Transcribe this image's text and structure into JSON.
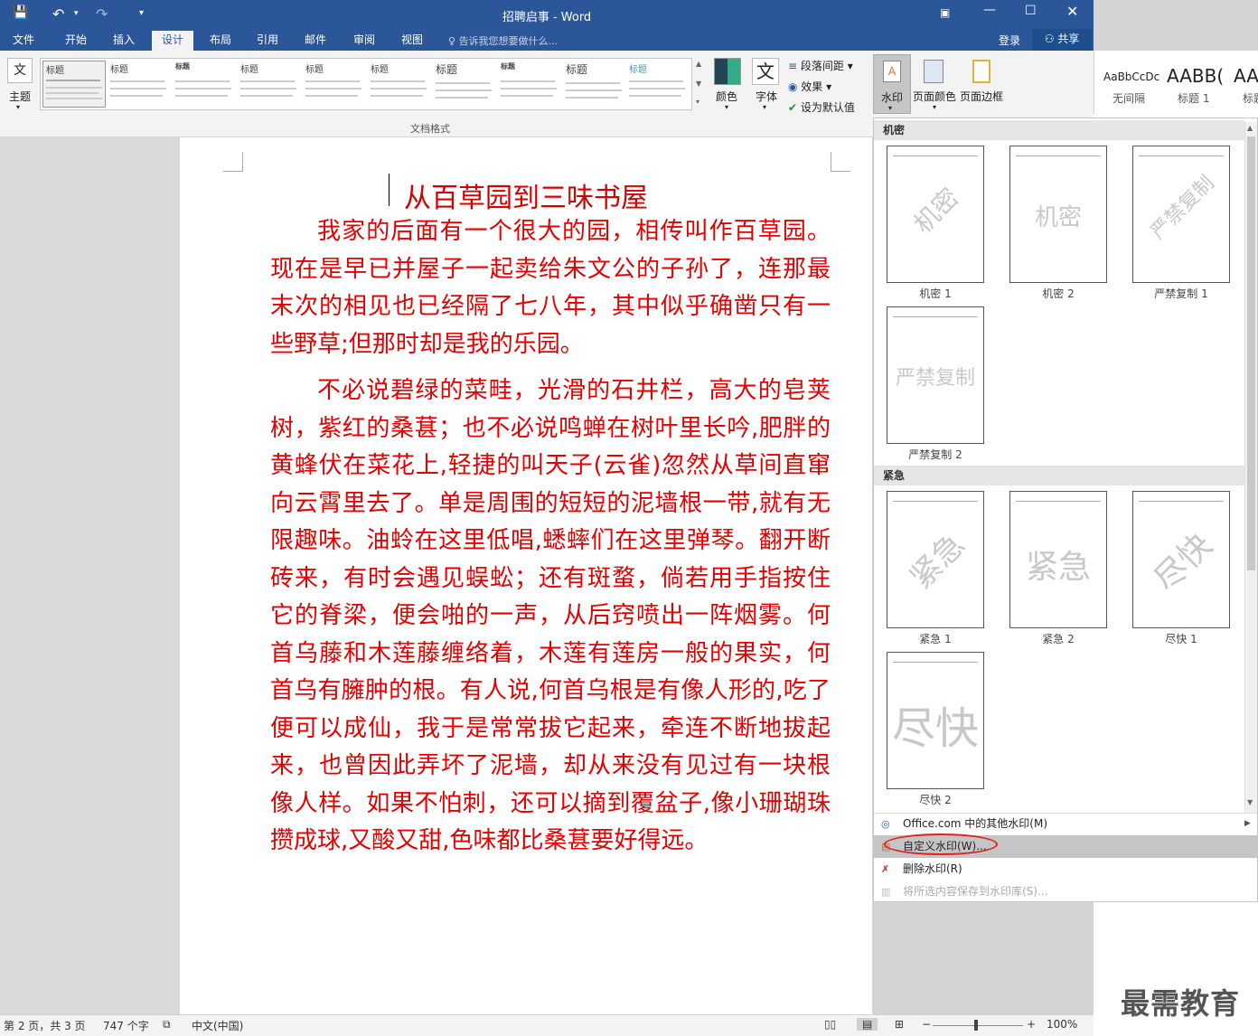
{
  "window": {
    "title": "招聘启事 - Word"
  },
  "qat": {
    "save": "💾",
    "undo": "↶",
    "redo": "↷",
    "more": "▾"
  },
  "tabs": [
    "文件",
    "开始",
    "插入",
    "设计",
    "布局",
    "引用",
    "邮件",
    "审阅",
    "视图"
  ],
  "tell_me": "告诉我您想要做什么...",
  "account": {
    "login": "登录",
    "share": "共享"
  },
  "ribbon": {
    "theme_label": "主题",
    "gallery_title_words": [
      "标题",
      "标题",
      "标题",
      "标题",
      "标题",
      "标题",
      "标题",
      "标题",
      "标题",
      "标题"
    ],
    "group_label": "文档格式",
    "colors_label": "颜色",
    "fonts_label": "字体",
    "font_glyph": "文",
    "paragraph_spacing": "段落间距",
    "effects": "效果",
    "set_default": "设为默认值",
    "watermark": "水印",
    "page_color": "页面颜色",
    "page_borders": "页面边框"
  },
  "styles_pane": {
    "items": [
      {
        "sample": "AaBbCcDc",
        "label": "无间隔"
      },
      {
        "sample": "AABB(",
        "label": "标题 1"
      },
      {
        "sample": "AAE",
        "label": "标题"
      }
    ]
  },
  "document": {
    "title": "从百草园到三味书屋",
    "paragraphs": [
      "我家的后面有一个很大的园，相传叫作百草园。现在是早已并屋子一起卖给朱文公的子孙了，连那最末次的相见也已经隔了七八年，其中似乎确凿只有一些野草;但那时却是我的乐园。",
      "不必说碧绿的菜畦，光滑的石井栏，高大的皂荚树，紫红的桑葚；也不必说鸣蝉在树叶里长吟,肥胖的黄蜂伏在菜花上,轻捷的叫天子(云雀)忽然从草间直窜向云霄里去了。单是周围的短短的泥墙根一带,就有无限趣味。油蛉在这里低唱,蟋蟀们在这里弹琴。翻开断砖来，有时会遇见蜈蚣；还有斑蝥，倘若用手指按住它的脊梁，便会啪的一声，从后窍喷出一阵烟雾。何首乌藤和木莲藤缠络着，木莲有莲房一般的果实，何首乌有臃肿的根。有人说,何首乌根是有像人形的,吃了便可以成仙，我于是常常拔它起来，牵连不断地拔起来，也曾因此弄坏了泥墙，却从来没有见过有一块根像人样。如果不怕刺，还可以摘到覆盆子,像小珊瑚珠攒成球,又酸又甜,色味都比桑葚要好得远。"
    ]
  },
  "watermark_menu": {
    "sections": [
      {
        "header": "机密",
        "items": [
          {
            "label": "机密 1",
            "text": "机密",
            "style": "diagonal"
          },
          {
            "label": "机密 2",
            "text": "机密",
            "style": "horizontal"
          },
          {
            "label": "严禁复制 1",
            "text": "严禁复制",
            "style": "diagonal"
          },
          {
            "label": "严禁复制 2",
            "text": "严禁复制",
            "style": "horizontal"
          }
        ]
      },
      {
        "header": "紧急",
        "items": [
          {
            "label": "紧急 1",
            "text": "紧急",
            "style": "diagonal"
          },
          {
            "label": "紧急 2",
            "text": "紧急",
            "style": "horizontal"
          },
          {
            "label": "尽快 1",
            "text": "尽快",
            "style": "diagonal"
          },
          {
            "label": "尽快 2",
            "text": "尽快",
            "style": "horizontal"
          }
        ]
      }
    ],
    "commands": [
      {
        "label": "Office.com 中的其他水印(M)",
        "state": "normal"
      },
      {
        "label": "自定义水印(W)...",
        "state": "highlighted"
      },
      {
        "label": "删除水印(R)",
        "state": "normal"
      },
      {
        "label": "将所选内容保存到水印库(S)...",
        "state": "disabled"
      }
    ]
  },
  "status": {
    "page": "第 2 页，共 3 页",
    "words": "747 个字",
    "language": "中文(中国)",
    "zoom": "100%"
  },
  "brand_logo_text": "最需教育"
}
